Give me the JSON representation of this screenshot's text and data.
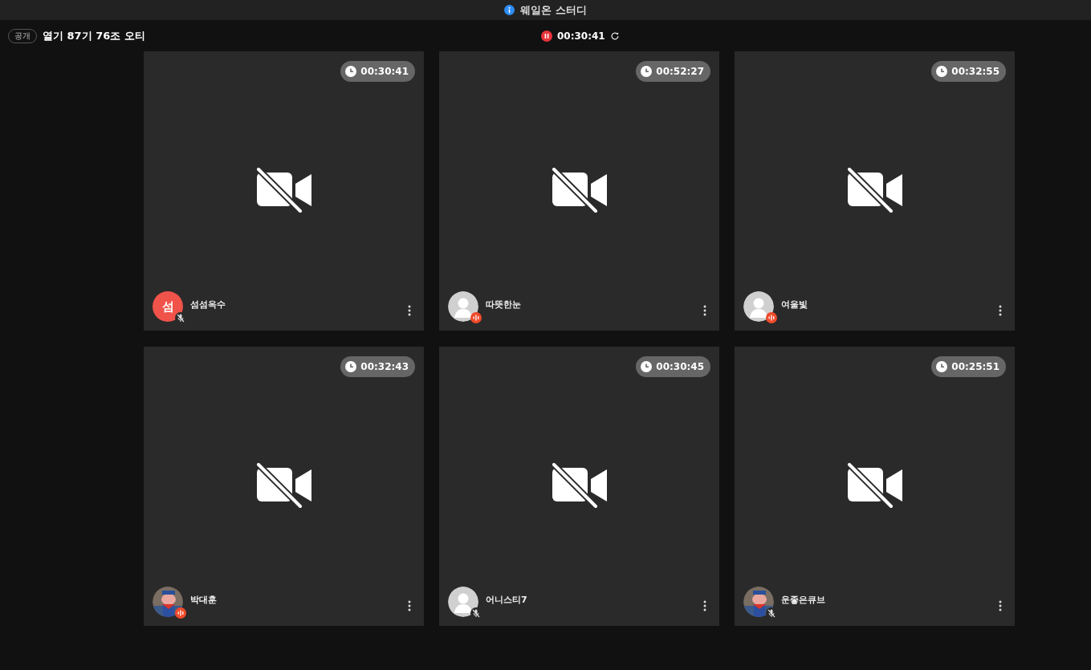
{
  "window": {
    "title": "웨일온 스터디"
  },
  "room": {
    "visibility": "공개",
    "name": "열기 87기 76조 오티",
    "recording": true,
    "elapsed": "00:30:41"
  },
  "participants": [
    {
      "name": "섬섬옥수",
      "elapsed": "00:30:41",
      "avatar": {
        "kind": "initial",
        "text": "섬",
        "color": "#f0534a"
      },
      "muted": true
    },
    {
      "name": "따뜻한눈",
      "elapsed": "00:52:27",
      "avatar": {
        "kind": "default"
      },
      "muted": false
    },
    {
      "name": "여울빛",
      "elapsed": "00:32:55",
      "avatar": {
        "kind": "default"
      },
      "muted": false
    },
    {
      "name": "박대훈",
      "elapsed": "00:32:43",
      "muted": false
    },
    {
      "name": "어니스티7",
      "elapsed": "00:30:45",
      "avatar": {
        "kind": "default"
      },
      "muted": true
    },
    {
      "name": "운좋은큐브",
      "elapsed": "00:25:51",
      "muted": true
    }
  ]
}
